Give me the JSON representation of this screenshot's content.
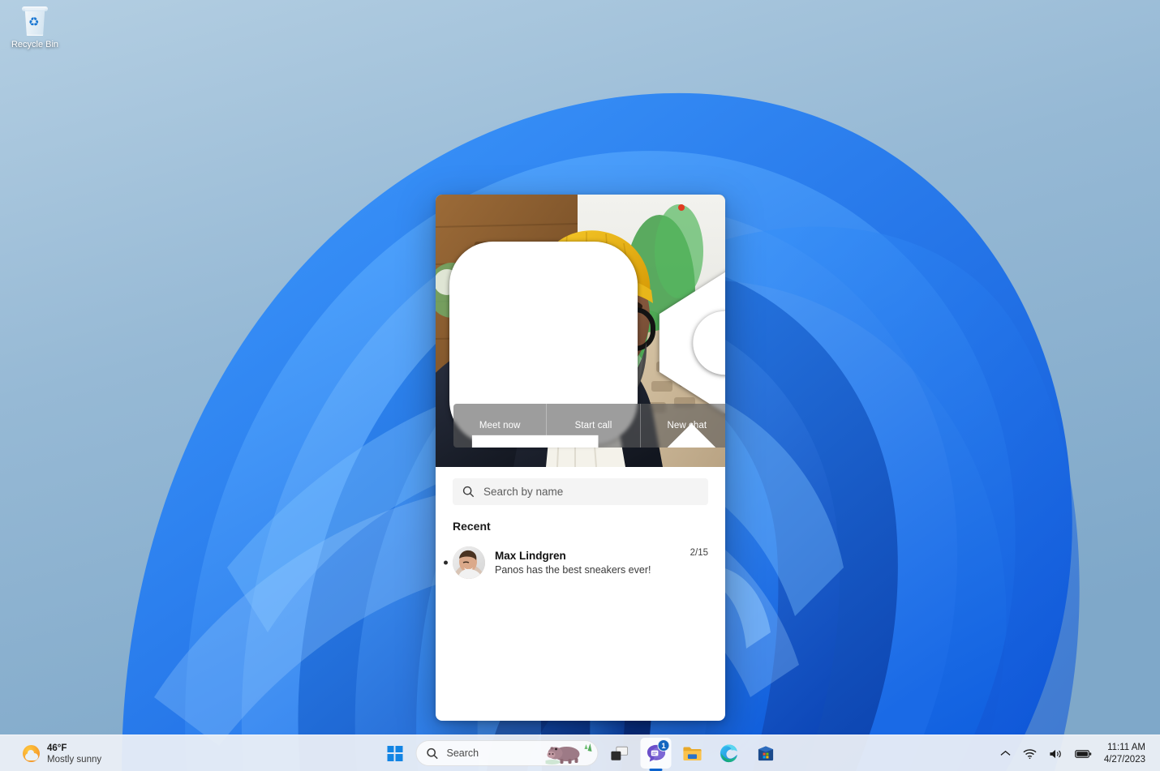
{
  "desktop": {
    "icons": [
      {
        "label": "Recycle Bin",
        "icon": "recycle-bin-icon"
      }
    ]
  },
  "flyout": {
    "hero": {
      "camera_icon": "video-camera-icon",
      "more_icon": "more-options-icon",
      "expand_icon": "open-expand-icon",
      "has_notification_dot": true
    },
    "actions": [
      {
        "label": "Meet now",
        "icon": "link-icon"
      },
      {
        "label": "Start call",
        "icon": "video-call-add-icon"
      },
      {
        "label": "New chat",
        "icon": "compose-pencil-icon"
      }
    ],
    "search": {
      "placeholder": "Search by name",
      "icon": "search-icon",
      "value": ""
    },
    "recent_header": "Recent",
    "chats": [
      {
        "name": "Max Lindgren",
        "message": "Panos has the best sneakers ever!",
        "time": "2/15",
        "unread": true
      }
    ]
  },
  "taskbar": {
    "weather": {
      "temperature": "46°F",
      "condition": "Mostly sunny",
      "icon": "sun-cloud-icon"
    },
    "start": {
      "label": "Start",
      "icon": "windows-logo-icon"
    },
    "search": {
      "placeholder": "Search",
      "icon": "search-icon",
      "art": "hippo-icon"
    },
    "apps": [
      {
        "name": "task-view",
        "label": "Task View",
        "icon": "task-view-icon",
        "active": false,
        "badge": ""
      },
      {
        "name": "teams-chat",
        "label": "Chat",
        "icon": "teams-chat-icon",
        "active": true,
        "badge": "1"
      },
      {
        "name": "file-explorer",
        "label": "File Explorer",
        "icon": "folder-icon",
        "active": false,
        "badge": ""
      },
      {
        "name": "microsoft-edge",
        "label": "Microsoft Edge",
        "icon": "edge-icon",
        "active": false,
        "badge": ""
      },
      {
        "name": "microsoft-store",
        "label": "Microsoft Store",
        "icon": "store-icon",
        "active": false,
        "badge": ""
      }
    ],
    "tray": {
      "chevron_icon": "chevron-up-icon",
      "wifi_icon": "wifi-icon",
      "volume_icon": "speaker-icon",
      "battery_icon": "battery-icon"
    },
    "clock": {
      "time": "11:11 AM",
      "date": "4/27/2023"
    }
  },
  "colors": {
    "accent": "#0b63ce",
    "badge": "#1566c0",
    "taskbar": "#eef1f6",
    "notification_dot": "#e03a20"
  }
}
